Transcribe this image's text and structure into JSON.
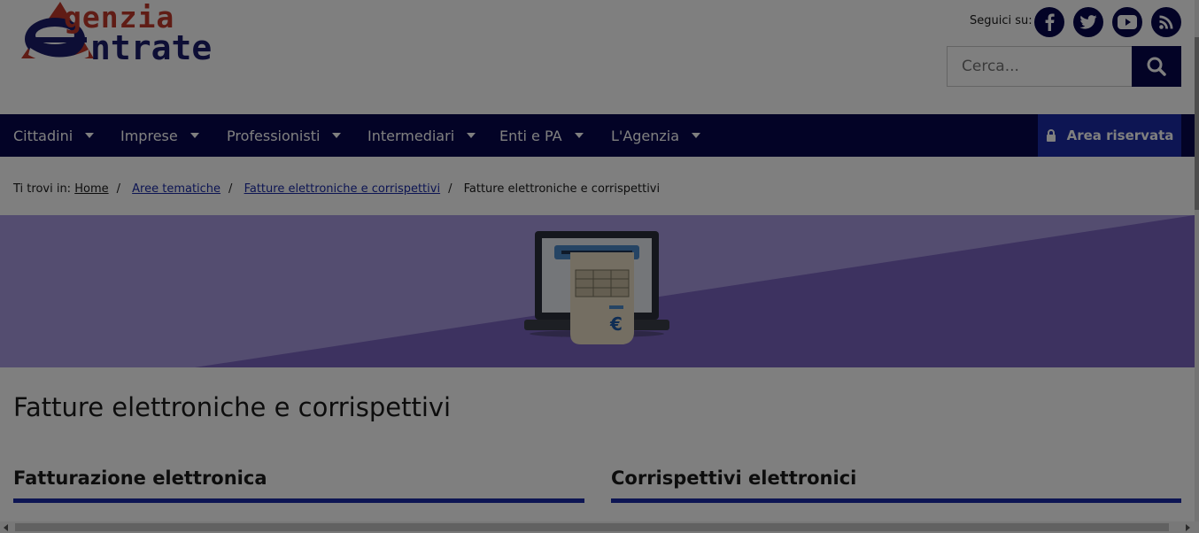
{
  "header": {
    "logo_top": "genzia",
    "logo_bottom": "ntrate",
    "social_label": "Seguici su:",
    "social": [
      {
        "icon": "facebook-icon",
        "glyph": "f"
      },
      {
        "icon": "twitter-icon"
      },
      {
        "icon": "youtube-icon"
      },
      {
        "icon": "rss-icon"
      }
    ],
    "search_placeholder": "Cerca..."
  },
  "nav": {
    "items": [
      {
        "label": "Cittadini"
      },
      {
        "label": "Imprese"
      },
      {
        "label": "Professionisti"
      },
      {
        "label": "Intermediari"
      },
      {
        "label": "Enti e PA"
      },
      {
        "label": "L'Agenzia"
      }
    ],
    "area_label": "Area riservata"
  },
  "breadcrumb": {
    "prefix": "Ti trovi in:",
    "links": [
      "Home",
      "Aree tematiche",
      "Fatture elettroniche e corrispettivi"
    ],
    "current": "Fatture elettroniche e corrispettivi"
  },
  "banner": {
    "euro": "€"
  },
  "main": {
    "title": "Fatture elettroniche e corrispettivi",
    "sections": [
      "Fatturazione elettronica",
      "Corrispettivi elettronici"
    ]
  },
  "colors": {
    "brand_navy": "#06064d",
    "accent_blue": "#1a2aa6",
    "banner_purple": "#8e7fc7",
    "logo_red": "#c0392b"
  }
}
